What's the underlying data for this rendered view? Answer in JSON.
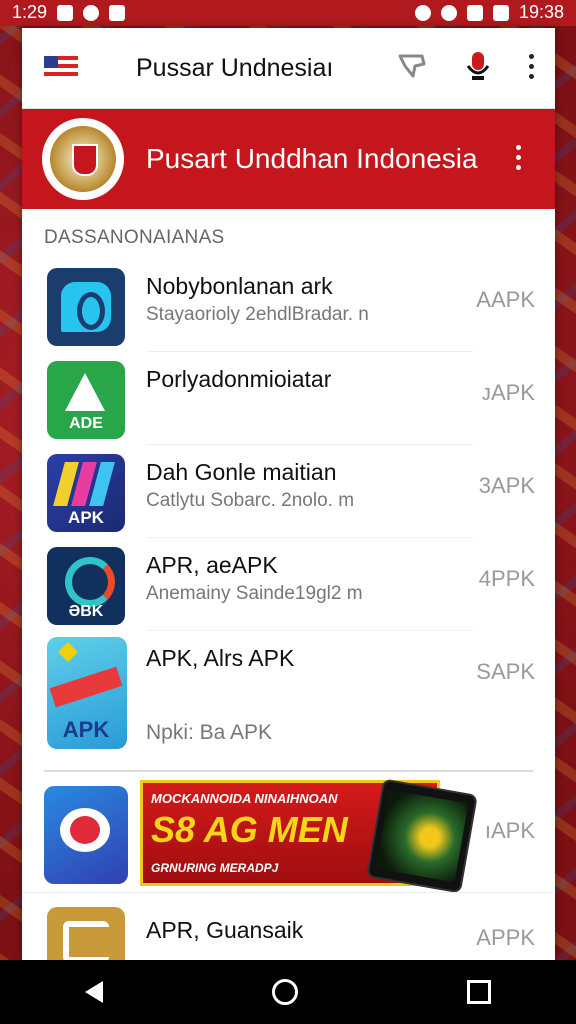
{
  "status_bar": {
    "time_left": "1:29",
    "time_right": "19:38"
  },
  "app_bar": {
    "title": "Pussar Undnesiaı"
  },
  "banner": {
    "title": "Pusart Unddhan Indonesia"
  },
  "section": {
    "heading": "DASSANONAIANAS"
  },
  "apps": [
    {
      "name": "Nobybonlanan ark",
      "subtitle": "Stayaorioly 2ehdlBradar. n",
      "tag": "AAPK",
      "icon": "chat-bubble-app-icon"
    },
    {
      "name": "Porlyadonmioiatar",
      "subtitle": "",
      "tag": "ᴊAPK",
      "icon": "ade-app-icon",
      "icon_label": "ADE"
    },
    {
      "name": "Dah Gonle maitian",
      "subtitle": "Catlytu Sobarc. 2nolo.  m",
      "tag": "3APK",
      "icon": "apk-stripes-app-icon",
      "icon_label": "APK"
    },
    {
      "name": "APR, aeAPK",
      "subtitle": "Anemainy Saindе19gl2 m",
      "tag": "4PPK",
      "icon": "ebk-app-icon",
      "icon_label": "ƏBK"
    },
    {
      "name": "APK, Alrs APK",
      "subtitle": "Npki: Ba APK",
      "tag": "SAPK",
      "icon": "apk-game-app-icon",
      "icon_label": "APK"
    }
  ],
  "promo": {
    "line1": "MOCKANNOIDA NINAIHNOAN",
    "line2": "S8 AG MEN",
    "line3": "GRNURING MERADPJ",
    "tag": "ıAPK"
  },
  "last_app": {
    "name": "APR, Guansaik",
    "tag": "APPK"
  }
}
